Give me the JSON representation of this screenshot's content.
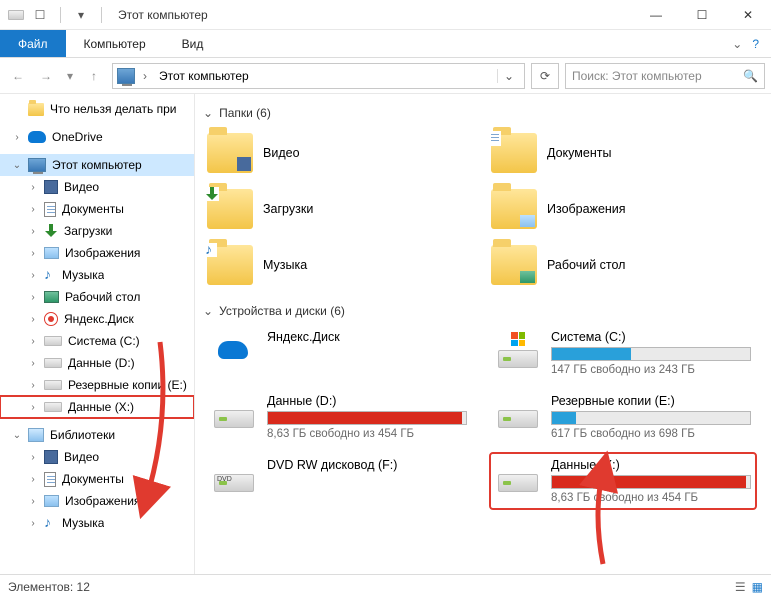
{
  "window": {
    "title": "Этот компьютер"
  },
  "ribbon": {
    "file": "Файл",
    "computer": "Компьютер",
    "view": "Вид"
  },
  "address": {
    "crumb": "Этот компьютер"
  },
  "search": {
    "placeholder": "Поиск: Этот компьютер"
  },
  "sidebar": {
    "top": [
      {
        "icon": "folder",
        "label": "Что нельзя делать при"
      }
    ],
    "onedrive": "OneDrive",
    "thispc": "Этот компьютер",
    "pcItems": [
      {
        "icon": "film",
        "label": "Видео"
      },
      {
        "icon": "doc",
        "label": "Документы"
      },
      {
        "icon": "dl",
        "label": "Загрузки"
      },
      {
        "icon": "img",
        "label": "Изображения"
      },
      {
        "icon": "music",
        "label": "Музыка"
      },
      {
        "icon": "desk",
        "label": "Рабочий стол"
      },
      {
        "icon": "yd",
        "label": "Яндекс.Диск"
      },
      {
        "icon": "hdd",
        "label": "Система (C:)"
      },
      {
        "icon": "hdd",
        "label": "Данные (D:)"
      },
      {
        "icon": "hdd",
        "label": "Резервные копии (E:)"
      },
      {
        "icon": "hdd",
        "label": "Данные (X:)",
        "hl": true
      }
    ],
    "libraries": "Библиотеки",
    "libItems": [
      {
        "icon": "film",
        "label": "Видео"
      },
      {
        "icon": "doc",
        "label": "Документы"
      },
      {
        "icon": "img",
        "label": "Изображения"
      },
      {
        "icon": "music",
        "label": "Музыка"
      }
    ]
  },
  "groups": {
    "folders": {
      "title": "Папки (6)"
    },
    "devices": {
      "title": "Устройства и диски (6)"
    }
  },
  "folders": [
    {
      "name": "Видео",
      "ov": "film"
    },
    {
      "name": "Документы",
      "ov": "doc"
    },
    {
      "name": "Загрузки",
      "ov": "dl"
    },
    {
      "name": "Изображения",
      "ov": "img"
    },
    {
      "name": "Музыка",
      "ov": "music"
    },
    {
      "name": "Рабочий стол",
      "ov": "desk"
    }
  ],
  "drives": [
    {
      "type": "yd",
      "name": "Яндекс.Диск",
      "bar": false
    },
    {
      "type": "os",
      "name": "Система (C:)",
      "sub": "147 ГБ свободно из 243 ГБ",
      "fillPct": 40,
      "fill": "#29a0da"
    },
    {
      "type": "hdd",
      "name": "Данные (D:)",
      "sub": "8,63 ГБ свободно из 454 ГБ",
      "fillPct": 98,
      "fill": "#d92a1c"
    },
    {
      "type": "hdd",
      "name": "Резервные копии (E:)",
      "sub": "617 ГБ свободно из 698 ГБ",
      "fillPct": 12,
      "fill": "#29a0da"
    },
    {
      "type": "dvd",
      "name": "DVD RW дисковод (F:)",
      "bar": false
    },
    {
      "type": "hdd",
      "name": "Данные (X:)",
      "sub": "8,63 ГБ свободно из 454 ГБ",
      "fillPct": 98,
      "fill": "#d92a1c",
      "hl": true
    }
  ],
  "status": {
    "text": "Элементов: 12"
  }
}
